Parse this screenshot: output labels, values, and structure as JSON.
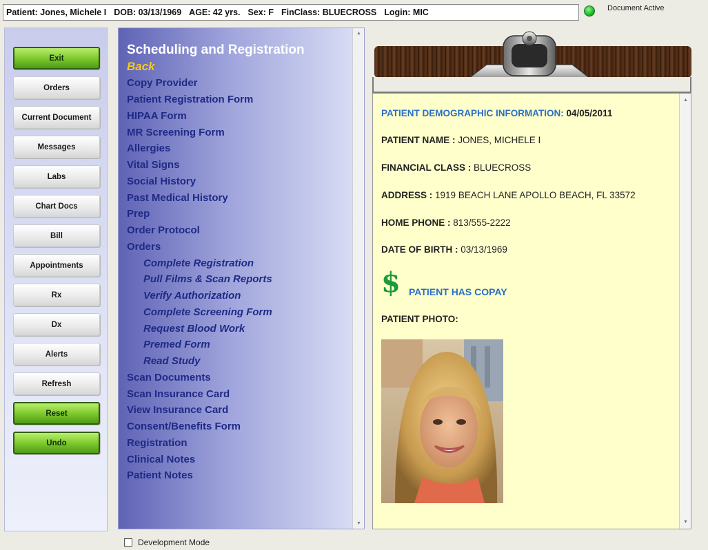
{
  "header": {
    "patient": "Patient: Jones, Michele I",
    "dob": "DOB: 03/13/1969",
    "age": "AGE: 42 yrs.",
    "sex": "Sex: F",
    "finclass": "FinClass: BLUECROSS",
    "login": "Login: MIC",
    "status": "Document Active",
    "status_color": "#1fbf2a"
  },
  "buttons": [
    {
      "label": "Exit",
      "style": "green"
    },
    {
      "label": "Orders",
      "style": "gray"
    },
    {
      "label": "Current Document",
      "style": "gray"
    },
    {
      "label": "Messages",
      "style": "gray"
    },
    {
      "label": "Labs",
      "style": "gray"
    },
    {
      "label": "Chart Docs",
      "style": "gray"
    },
    {
      "label": "Bill",
      "style": "gray"
    },
    {
      "label": "Appointments",
      "style": "gray"
    },
    {
      "label": "Rx",
      "style": "gray"
    },
    {
      "label": "Dx",
      "style": "gray"
    },
    {
      "label": "Alerts",
      "style": "gray"
    },
    {
      "label": "Refresh",
      "style": "gray"
    },
    {
      "label": "Reset",
      "style": "green"
    },
    {
      "label": "Undo",
      "style": "green"
    }
  ],
  "menu": {
    "title": "Scheduling and Registration",
    "back": "Back",
    "items": [
      {
        "label": "Copy Provider",
        "sub": false
      },
      {
        "label": "Patient Registration Form",
        "sub": false
      },
      {
        "label": "HIPAA Form",
        "sub": false
      },
      {
        "label": "MR Screening Form",
        "sub": false
      },
      {
        "label": "Allergies",
        "sub": false
      },
      {
        "label": "Vital Signs",
        "sub": false
      },
      {
        "label": "Social History",
        "sub": false
      },
      {
        "label": "Past Medical History",
        "sub": false
      },
      {
        "label": "Prep",
        "sub": false
      },
      {
        "label": "Order Protocol",
        "sub": false
      },
      {
        "label": "Orders",
        "sub": false
      },
      {
        "label": "Complete Registration",
        "sub": true
      },
      {
        "label": "Pull Films & Scan Reports",
        "sub": true
      },
      {
        "label": "Verify Authorization",
        "sub": true
      },
      {
        "label": "Complete Screening Form",
        "sub": true
      },
      {
        "label": "Request Blood Work",
        "sub": true
      },
      {
        "label": "Premed Form",
        "sub": true
      },
      {
        "label": "Read Study",
        "sub": true
      },
      {
        "label": "Scan Documents",
        "sub": false
      },
      {
        "label": "Scan Insurance Card",
        "sub": false
      },
      {
        "label": "View Insurance Card",
        "sub": false
      },
      {
        "label": "Consent/Benefits Form",
        "sub": false
      },
      {
        "label": "Registration",
        "sub": false
      },
      {
        "label": "Clinical Notes",
        "sub": false
      },
      {
        "label": "Patient Notes",
        "sub": false
      }
    ]
  },
  "document": {
    "heading": "PATIENT DEMOGRAPHIC INFORMATION:",
    "heading_date": "04/05/2011",
    "fields": [
      {
        "label": "PATIENT NAME :",
        "value": "JONES, MICHELE I"
      },
      {
        "label": "FINANCIAL CLASS :",
        "value": "BLUECROSS"
      },
      {
        "label": "ADDRESS :",
        "value": "1919 BEACH LANE APOLLO BEACH, FL 33572"
      },
      {
        "label": "HOME PHONE :",
        "value": "813/555-2222"
      },
      {
        "label": "DATE OF BIRTH :",
        "value": "03/13/1969"
      }
    ],
    "copay_icon": "$",
    "copay_text": "PATIENT HAS COPAY",
    "photo_label": "PATIENT PHOTO:"
  },
  "footer": {
    "dev_mode_label": "Development Mode"
  }
}
